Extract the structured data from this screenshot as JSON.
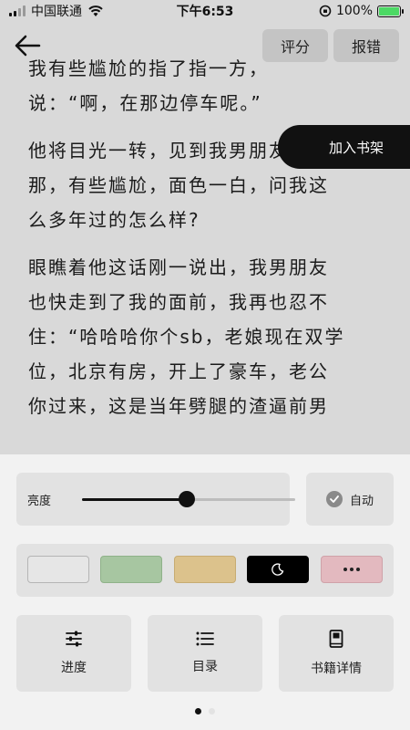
{
  "status_bar": {
    "carrier": "中国联通",
    "time": "下午6:53",
    "battery_percent": "100%",
    "battery_level": 1.0,
    "icons": [
      "signal-icon",
      "wifi-icon",
      "orientation-lock-icon",
      "battery-charging-icon"
    ]
  },
  "top_bar": {
    "back_icon": "back-arrow-icon",
    "rate_label": "评分",
    "report_label": "报错"
  },
  "reading": {
    "paragraphs": [
      [
        "我有些尴尬的指了指一方，",
        "说：“啊，在那边停车呢。”"
      ],
      [
        "他将目光一转，见到我男朋友",
        "那，有些尴尬，面色一白，问我这",
        "么多年过的怎么样?"
      ],
      [
        "眼瞧着他这话刚一说出，我男朋友",
        "也快走到了我的面前，我再也忍不",
        "住：“哈哈哈你个sb，老娘现在双学",
        "位，北京有房，开上了豪车，老公",
        "你过来，这是当年劈腿的渣逼前男"
      ]
    ]
  },
  "shelf_button": {
    "label": "加入书架"
  },
  "settings": {
    "brightness_label": "亮度",
    "brightness_level": 0.49,
    "auto_label": "自动",
    "themes": [
      {
        "name": "light",
        "color": "#e6e6e6",
        "border": "#b5b5b5"
      },
      {
        "name": "green",
        "color": "#a7c6a1",
        "border": "#8fb289"
      },
      {
        "name": "tan",
        "color": "#dcc28c",
        "border": "#c7ac73"
      },
      {
        "name": "night",
        "color": "#000000",
        "border": "#000000",
        "icon": "moon-icon"
      },
      {
        "name": "more",
        "color": "#e3b9bf",
        "border": "#cfa2a9",
        "icon": "more-dots-icon"
      }
    ],
    "nav": [
      {
        "label": "进度",
        "icon": "sliders-icon"
      },
      {
        "label": "目录",
        "icon": "list-icon"
      },
      {
        "label": "书籍详情",
        "icon": "book-icon"
      }
    ],
    "pager": {
      "pages": 2,
      "active": 0
    }
  },
  "colors": {
    "page_bg": "#d9d9d9",
    "panel_bg": "#f2f2f2",
    "accent": "#111111"
  }
}
